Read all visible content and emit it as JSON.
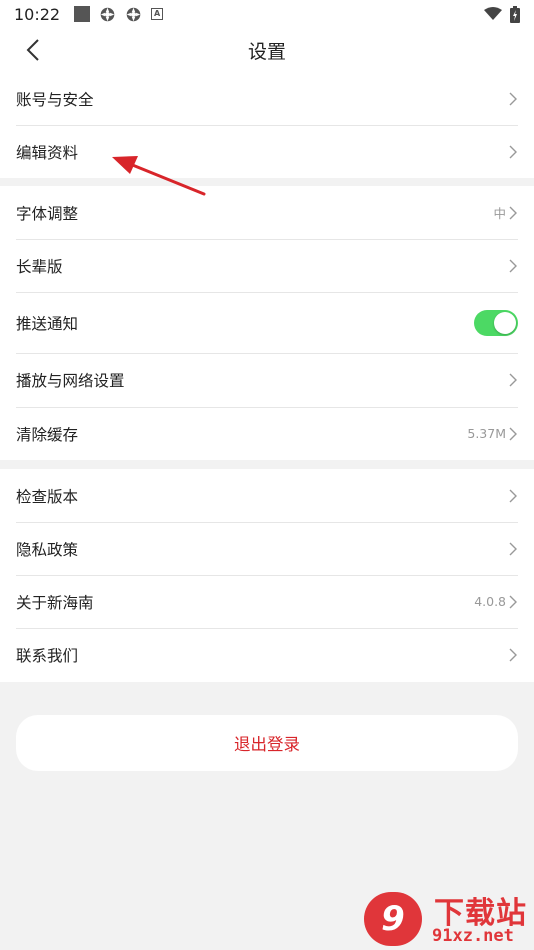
{
  "status_bar": {
    "time": "10:22",
    "icons": [
      "square-icon",
      "gear-icon",
      "gear-icon",
      "a-icon",
      "wifi-icon",
      "battery-icon"
    ]
  },
  "header": {
    "title": "设置"
  },
  "groups": [
    {
      "items": [
        {
          "label": "账号与安全"
        },
        {
          "label": "编辑资料"
        }
      ]
    },
    {
      "items": [
        {
          "label": "字体调整",
          "value": "中"
        },
        {
          "label": "长辈版"
        },
        {
          "label": "推送通知",
          "toggle": true
        },
        {
          "label": "播放与网络设置"
        },
        {
          "label": "清除缓存",
          "value": "5.37M"
        }
      ]
    },
    {
      "items": [
        {
          "label": "检查版本"
        },
        {
          "label": "隐私政策"
        },
        {
          "label": "关于新海南",
          "value": "4.0.8"
        },
        {
          "label": "联系我们"
        }
      ]
    }
  ],
  "logout_label": "退出登录",
  "colors": {
    "accent_red": "#d8252a",
    "toggle_on": "#4cd964",
    "background": "#f2f2f2",
    "annotation_arrow": "#d8252a"
  },
  "watermark": {
    "logo": "9",
    "title": "下载站",
    "url": "91xz.net"
  }
}
